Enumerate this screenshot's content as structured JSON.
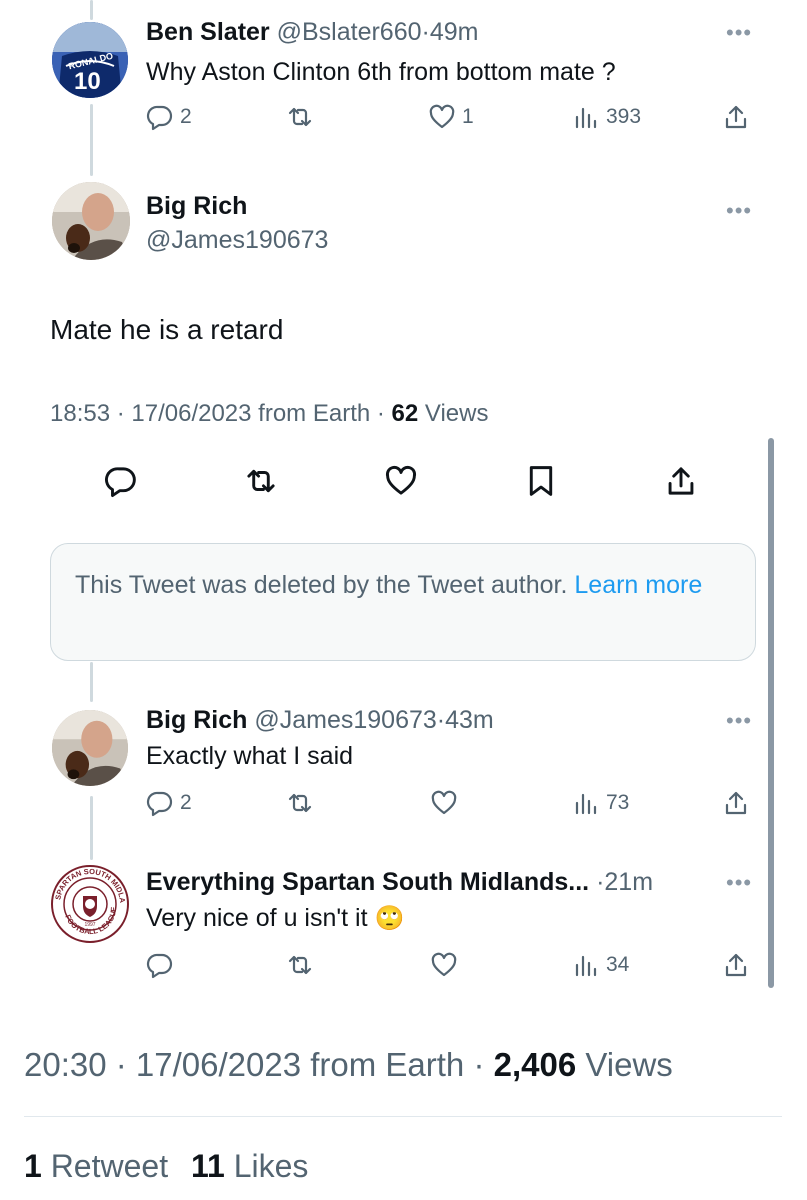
{
  "tweet1": {
    "name": "Ben Slater",
    "handle": "@Bslater660",
    "sep": "·",
    "time": "49m",
    "text": "Why Aston Clinton 6th from bottom mate ?",
    "avatar_number": "10",
    "avatar_caption": "RONALDO",
    "replies": "2",
    "likes": "1",
    "views": "393",
    "more": "•••"
  },
  "main_tweet": {
    "name": "Big Rich",
    "handle": "@James190673",
    "text": "Mate he is a retard",
    "meta_time": "18:53 · 17/06/2023 from Earth · ",
    "views_count": "62",
    "views_label": " Views",
    "more": "•••"
  },
  "deleted": {
    "text": "This Tweet was deleted by the Tweet author. ",
    "link": "Learn more"
  },
  "tweet3": {
    "name": "Big Rich",
    "handle": "@James190673",
    "sep": "·",
    "time": "43m",
    "text": "Exactly what I said",
    "replies": "2",
    "views": "73",
    "more": "•••"
  },
  "tweet4": {
    "name": "Everything Spartan South Midlands...",
    "sep": "·",
    "time": "21m",
    "text": "Very nice of u isn't it",
    "emoji": "🙄",
    "views": "34",
    "logo_text_top": "SPARTAN SOUTH MIDLANDS",
    "logo_text_bottom": "FOOTBALL LEAGUE",
    "logo_year": "1997",
    "more": "•••"
  },
  "footer": {
    "meta_time": "20:30 · 17/06/2023 from Earth · ",
    "views_count": "2,406",
    "views_label": " Views",
    "retweet_count": "1",
    "retweet_label": " Retweet",
    "likes_count": "11",
    "likes_label": " Likes"
  },
  "colors": {
    "text": "#0f1419",
    "muted": "#536471",
    "link": "#1d9bf0",
    "border": "#cfd9de"
  },
  "icons": [
    "reply-icon",
    "retweet-icon",
    "like-icon",
    "views-icon",
    "share-icon",
    "bookmark-icon",
    "more-icon"
  ]
}
